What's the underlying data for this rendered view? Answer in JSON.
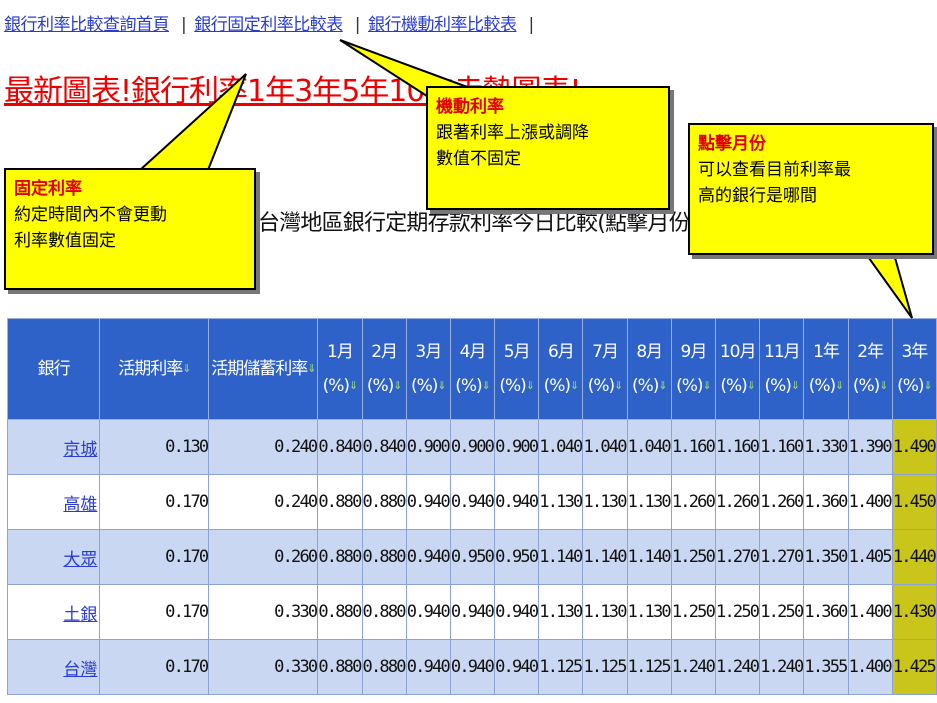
{
  "nav": {
    "links": [
      "銀行利率比較查詢首頁",
      "銀行固定利率比較表",
      "銀行機動利率比較表"
    ],
    "separator": "|"
  },
  "headline": "最新圖表!銀行利率1年3年5年10年走勢圖表!",
  "subtitle": "台灣地區銀行定期存款利率今日比較(點擊月份可排序):",
  "callouts": {
    "fixed": {
      "title": "固定利率",
      "lines": [
        "約定時間內不會更動",
        "利率數值固定"
      ]
    },
    "floating": {
      "title": "機動利率",
      "lines": [
        "跟著利率上漲或調降",
        "數值不固定"
      ]
    },
    "month": {
      "title": "點擊月份",
      "lines": [
        "可以查看目前利率最",
        "高的銀行是哪間"
      ]
    }
  },
  "table": {
    "headers": [
      {
        "l1": "銀行",
        "l2": ""
      },
      {
        "l1": "活期利率",
        "l2": ""
      },
      {
        "l1": "活期儲蓄利率",
        "l2": ""
      },
      {
        "l1": "1月",
        "l2": "(%)"
      },
      {
        "l1": "2月",
        "l2": "(%)"
      },
      {
        "l1": "3月",
        "l2": "(%)"
      },
      {
        "l1": "4月",
        "l2": "(%)"
      },
      {
        "l1": "5月",
        "l2": "(%)"
      },
      {
        "l1": "6月",
        "l2": "(%)"
      },
      {
        "l1": "7月",
        "l2": "(%)"
      },
      {
        "l1": "8月",
        "l2": "(%)"
      },
      {
        "l1": "9月",
        "l2": "(%)"
      },
      {
        "l1": "10月",
        "l2": "(%)"
      },
      {
        "l1": "11月",
        "l2": "(%)"
      },
      {
        "l1": "1年",
        "l2": "(%)"
      },
      {
        "l1": "2年",
        "l2": "(%)"
      },
      {
        "l1": "3年",
        "l2": "(%)"
      }
    ],
    "sort_arrow": "⇓",
    "highlight_color": "#c9c51a",
    "header_color": "#2f62c8",
    "rows": [
      {
        "bank": "京城",
        "vals": [
          "0.130",
          "0.240",
          "0.840",
          "0.840",
          "0.900",
          "0.900",
          "0.900",
          "1.040",
          "1.040",
          "1.040",
          "1.160",
          "1.160",
          "1.160",
          "1.330",
          "1.390",
          "1.490"
        ]
      },
      {
        "bank": "高雄",
        "vals": [
          "0.170",
          "0.240",
          "0.880",
          "0.880",
          "0.940",
          "0.940",
          "0.940",
          "1.130",
          "1.130",
          "1.130",
          "1.260",
          "1.260",
          "1.260",
          "1.360",
          "1.400",
          "1.450"
        ]
      },
      {
        "bank": "大眾",
        "vals": [
          "0.170",
          "0.260",
          "0.880",
          "0.880",
          "0.940",
          "0.950",
          "0.950",
          "1.140",
          "1.140",
          "1.140",
          "1.250",
          "1.270",
          "1.270",
          "1.350",
          "1.405",
          "1.440"
        ]
      },
      {
        "bank": "土銀",
        "vals": [
          "0.170",
          "0.330",
          "0.880",
          "0.880",
          "0.940",
          "0.940",
          "0.940",
          "1.130",
          "1.130",
          "1.130",
          "1.250",
          "1.250",
          "1.250",
          "1.360",
          "1.400",
          "1.430"
        ]
      },
      {
        "bank": "台灣",
        "vals": [
          "0.170",
          "0.330",
          "0.880",
          "0.880",
          "0.940",
          "0.940",
          "0.940",
          "1.125",
          "1.125",
          "1.125",
          "1.240",
          "1.240",
          "1.240",
          "1.355",
          "1.400",
          "1.425"
        ]
      }
    ]
  }
}
